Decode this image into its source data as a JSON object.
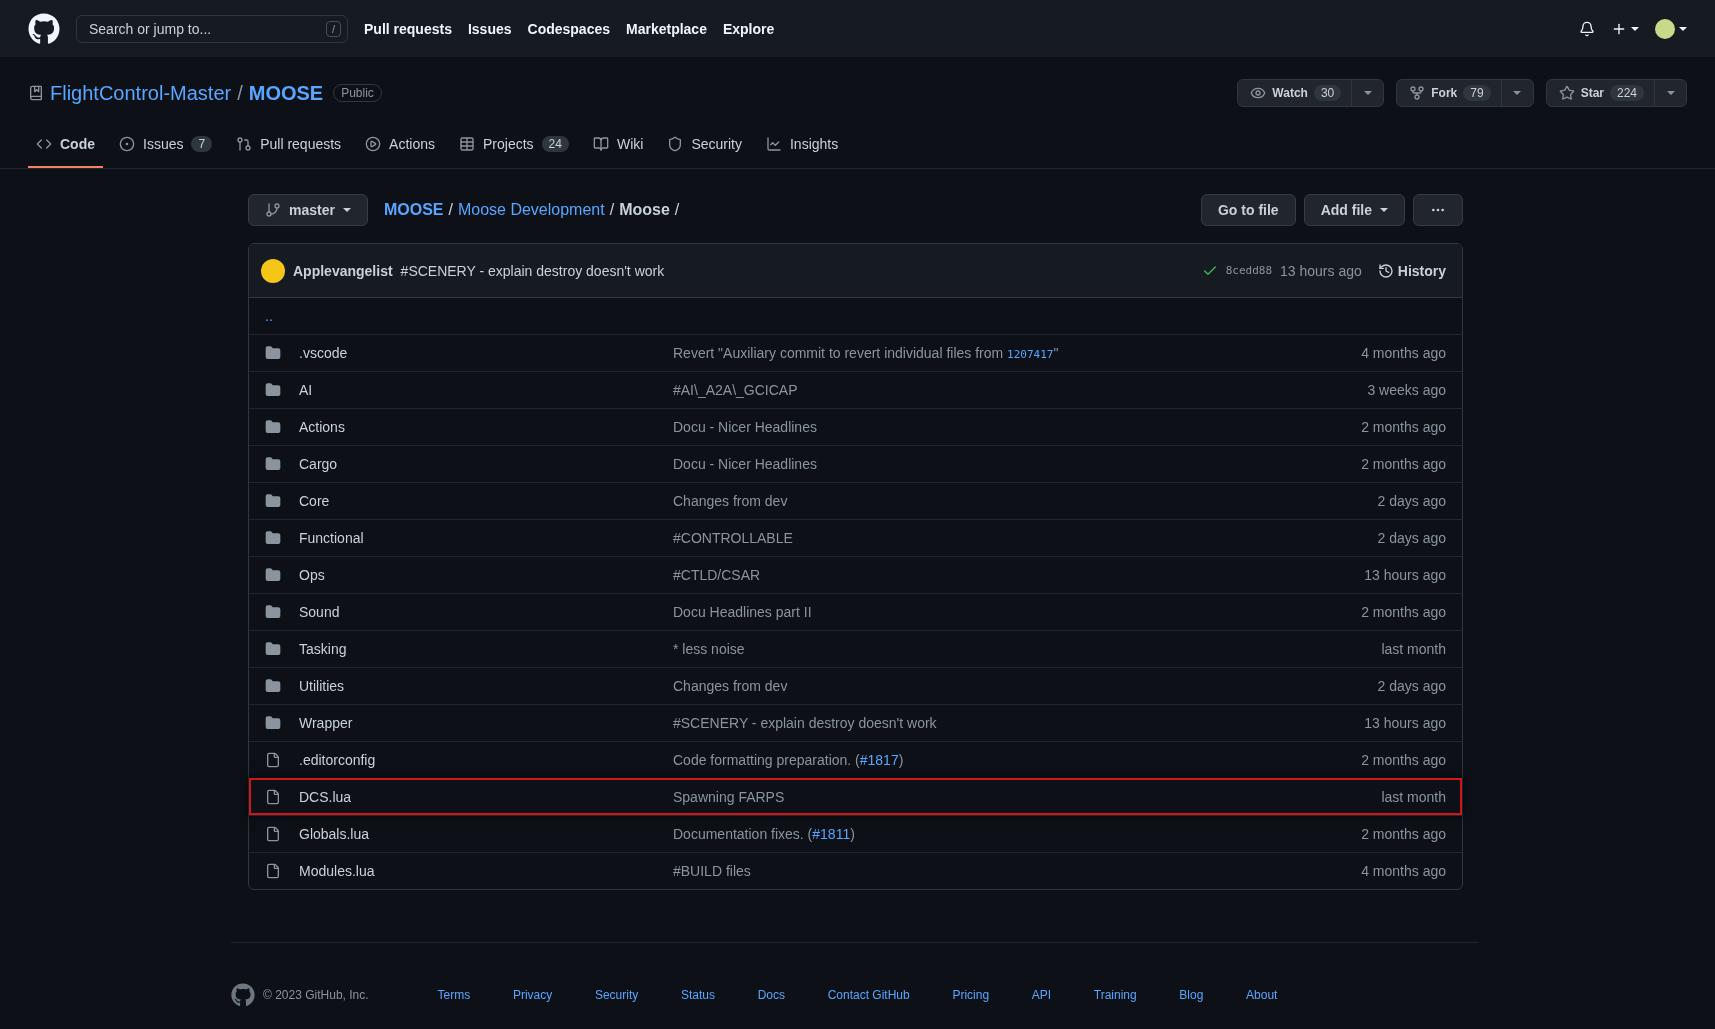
{
  "topbar": {
    "search": {
      "placeholder": "Search or jump to...",
      "shortcut": "/"
    },
    "nav": [
      "Pull requests",
      "Issues",
      "Codespaces",
      "Marketplace",
      "Explore"
    ]
  },
  "repo": {
    "owner": "FlightControl-Master",
    "separator": "/",
    "name": "MOOSE",
    "visibility": "Public",
    "actions": [
      {
        "kind": "watch",
        "label": "Watch",
        "count": "30"
      },
      {
        "kind": "fork",
        "label": "Fork",
        "count": "79"
      },
      {
        "kind": "star",
        "label": "Star",
        "count": "224"
      }
    ]
  },
  "tabs": [
    {
      "kind": "code",
      "label": "Code",
      "selected": true
    },
    {
      "kind": "issues",
      "label": "Issues",
      "count": "7",
      "selected": false
    },
    {
      "kind": "pulls",
      "label": "Pull requests",
      "selected": false
    },
    {
      "kind": "actions",
      "label": "Actions",
      "selected": false
    },
    {
      "kind": "projects",
      "label": "Projects",
      "count": "24",
      "selected": false
    },
    {
      "kind": "wiki",
      "label": "Wiki",
      "selected": false
    },
    {
      "kind": "security",
      "label": "Security",
      "selected": false
    },
    {
      "kind": "insights",
      "label": "Insights",
      "selected": false
    }
  ],
  "branch": "master",
  "breadcrumb": [
    {
      "text": "MOOSE",
      "kind": "root"
    },
    {
      "text": "/",
      "kind": "sep"
    },
    {
      "text": "Moose Development",
      "kind": "link"
    },
    {
      "text": "/",
      "kind": "sep"
    },
    {
      "text": "Moose",
      "kind": "current"
    },
    {
      "text": "/",
      "kind": "sep"
    }
  ],
  "file_actions": [
    "Go to file",
    "Add file"
  ],
  "commit": {
    "author": "Applevangelist",
    "message": "#SCENERY - explain destroy doesn't work",
    "sha": "8cedd88",
    "time": "13 hours ago",
    "history": "History"
  },
  "parent_link": "..",
  "files": [
    {
      "kind": "dir",
      "name": ".vscode",
      "message": [
        {
          "kind": "text",
          "text": "Revert \"Auxiliary commit to revert individual files from "
        },
        {
          "kind": "sha",
          "text": "1207417"
        },
        {
          "kind": "text",
          "text": "\""
        }
      ],
      "time": "4 months ago",
      "highlighted": false
    },
    {
      "kind": "dir",
      "name": "AI",
      "message": [
        {
          "kind": "text",
          "text": "#AI\\_A2A\\_GCICAP"
        }
      ],
      "time": "3 weeks ago",
      "highlighted": false
    },
    {
      "kind": "dir",
      "name": "Actions",
      "message": [
        {
          "kind": "text",
          "text": "Docu - Nicer Headlines"
        }
      ],
      "time": "2 months ago",
      "highlighted": false
    },
    {
      "kind": "dir",
      "name": "Cargo",
      "message": [
        {
          "kind": "text",
          "text": "Docu - Nicer Headlines"
        }
      ],
      "time": "2 months ago",
      "highlighted": false
    },
    {
      "kind": "dir",
      "name": "Core",
      "message": [
        {
          "kind": "text",
          "text": "Changes from dev"
        }
      ],
      "time": "2 days ago",
      "highlighted": false
    },
    {
      "kind": "dir",
      "name": "Functional",
      "message": [
        {
          "kind": "text",
          "text": "#CONTROLLABLE"
        }
      ],
      "time": "2 days ago",
      "highlighted": false
    },
    {
      "kind": "dir",
      "name": "Ops",
      "message": [
        {
          "kind": "text",
          "text": "#CTLD/CSAR"
        }
      ],
      "time": "13 hours ago",
      "highlighted": false
    },
    {
      "kind": "dir",
      "name": "Sound",
      "message": [
        {
          "kind": "text",
          "text": "Docu Headlines part II"
        }
      ],
      "time": "2 months ago",
      "highlighted": false
    },
    {
      "kind": "dir",
      "name": "Tasking",
      "message": [
        {
          "kind": "text",
          "text": "* less noise"
        }
      ],
      "time": "last month",
      "highlighted": false
    },
    {
      "kind": "dir",
      "name": "Utilities",
      "message": [
        {
          "kind": "text",
          "text": "Changes from dev"
        }
      ],
      "time": "2 days ago",
      "highlighted": false
    },
    {
      "kind": "dir",
      "name": "Wrapper",
      "message": [
        {
          "kind": "text",
          "text": "#SCENERY - explain destroy doesn't work"
        }
      ],
      "time": "13 hours ago",
      "highlighted": false
    },
    {
      "kind": "file",
      "name": ".editorconfig",
      "message": [
        {
          "kind": "text",
          "text": "Code formatting preparation. ("
        },
        {
          "kind": "link",
          "text": "#1817"
        },
        {
          "kind": "text",
          "text": ")"
        }
      ],
      "time": "2 months ago",
      "highlighted": false
    },
    {
      "kind": "file",
      "name": "DCS.lua",
      "message": [
        {
          "kind": "text",
          "text": "Spawning FARPS"
        }
      ],
      "time": "last month",
      "highlighted": true
    },
    {
      "kind": "file",
      "name": "Globals.lua",
      "message": [
        {
          "kind": "text",
          "text": "Documentation fixes. ("
        },
        {
          "kind": "link",
          "text": "#1811"
        },
        {
          "kind": "text",
          "text": ")"
        }
      ],
      "time": "2 months ago",
      "highlighted": false
    },
    {
      "kind": "file",
      "name": "Modules.lua",
      "message": [
        {
          "kind": "text",
          "text": "#BUILD files"
        }
      ],
      "time": "4 months ago",
      "highlighted": false
    }
  ],
  "footer": {
    "copyright": "© 2023 GitHub, Inc.",
    "links": [
      "Terms",
      "Privacy",
      "Security",
      "Status",
      "Docs",
      "Contact GitHub",
      "Pricing",
      "API",
      "Training",
      "Blog",
      "About"
    ]
  }
}
